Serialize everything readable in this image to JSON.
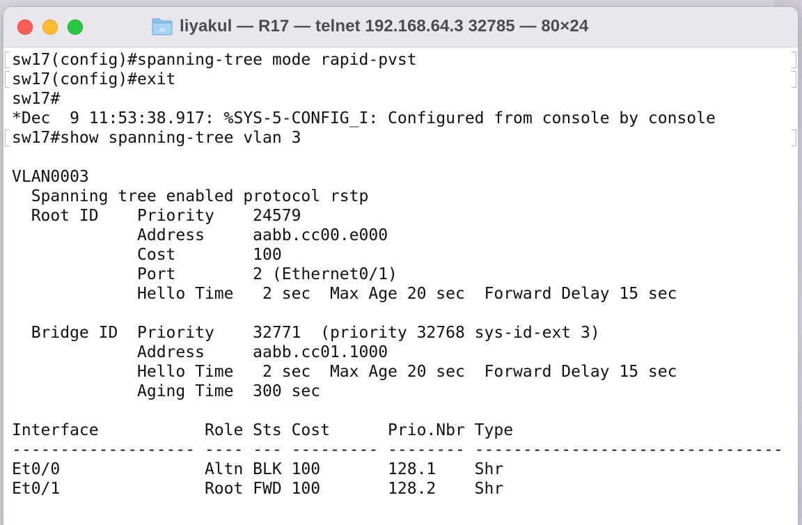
{
  "window": {
    "title": "liyakul — R17 — telnet 192.168.64.3 32785 — 80×24",
    "folder_icon": "folder-icon"
  },
  "colors": {
    "close": "#fd5f57",
    "minimize": "#febc2e",
    "maximize": "#28c840",
    "titlebar": "#e9e6ec",
    "text": "#111111"
  },
  "terminal": {
    "lines": [
      "sw17(config)#spanning-tree mode rapid-pvst",
      "sw17(config)#exit",
      "sw17#",
      "*Dec  9 11:53:38.917: %SYS-5-CONFIG_I: Configured from console by console",
      "sw17#show spanning-tree vlan 3",
      "",
      "VLAN0003",
      "  Spanning tree enabled protocol rstp",
      "  Root ID    Priority    24579",
      "             Address     aabb.cc00.e000",
      "             Cost        100",
      "             Port        2 (Ethernet0/1)",
      "             Hello Time   2 sec  Max Age 20 sec  Forward Delay 15 sec",
      "",
      "  Bridge ID  Priority    32771  (priority 32768 sys-id-ext 3)",
      "             Address     aabb.cc01.1000",
      "             Hello Time   2 sec  Max Age 20 sec  Forward Delay 15 sec",
      "             Aging Time  300 sec",
      "",
      "Interface           Role Sts Cost      Prio.Nbr Type",
      "------------------- ---- --- --------- -------- --------------------------------",
      "Et0/0               Altn BLK 100       128.1    Shr",
      "Et0/1               Root FWD 100       128.2    Shr"
    ]
  }
}
